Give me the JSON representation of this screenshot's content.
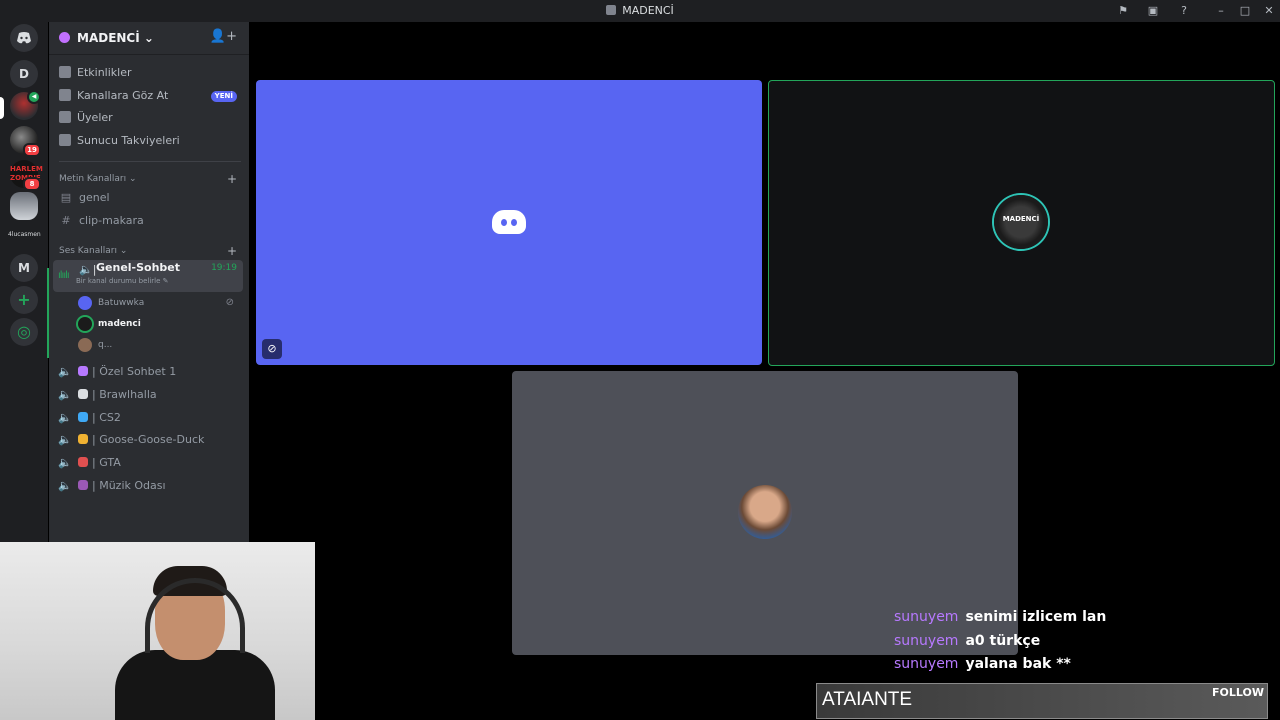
{
  "window": {
    "title": "MADENCİ"
  },
  "rail": {
    "letter_d": "D",
    "badge_1": "19",
    "badge_2": "8",
    "img3_text": "HARLEM ZOMBIE",
    "text_server": "4lucasmen",
    "letter_m": "M",
    "add": "+",
    "explore": "◎"
  },
  "server": {
    "name": "MADENCİ",
    "menu": [
      {
        "label": "Etkinlikler"
      },
      {
        "label": "Kanallara Göz At",
        "badge": "YENİ"
      },
      {
        "label": "Üyeler"
      },
      {
        "label": "Sunucu Takviyeleri"
      }
    ],
    "text_category": "Metin Kanalları",
    "text_channels": [
      "genel",
      "clip-makara"
    ],
    "voice_category": "Ses Kanalları",
    "active_channel": {
      "name": "Genel-Sohbet",
      "time": "19:19",
      "status": "Bir kanal durumu belirle"
    },
    "voice_users": [
      "Batuwwka",
      "madenci",
      "q..."
    ],
    "voice_channels": [
      {
        "label": "Özel Sohbet 1",
        "color": "#b779ff"
      },
      {
        "label": "Brawlhalla",
        "color": "#dbdee1"
      },
      {
        "label": "CS2",
        "color": "#3fa9f5"
      },
      {
        "label": "Goose-Goose-Duck",
        "color": "#f0b232"
      },
      {
        "label": "GTA",
        "color": "#e05050"
      },
      {
        "label": "Müzik Odası",
        "color": "#9b59b6"
      }
    ]
  },
  "tiles": {
    "logo_text": "MADENCİ"
  },
  "chat": [
    {
      "user": "sunuyem",
      "message": "senimi izlicem lan"
    },
    {
      "user": "sunuyem",
      "message": "a0 türkçe"
    },
    {
      "user": "sunuyem",
      "message": "yalana bak **"
    }
  ],
  "follow": {
    "name": "ATAIANTE",
    "label": "FOLLOW"
  }
}
